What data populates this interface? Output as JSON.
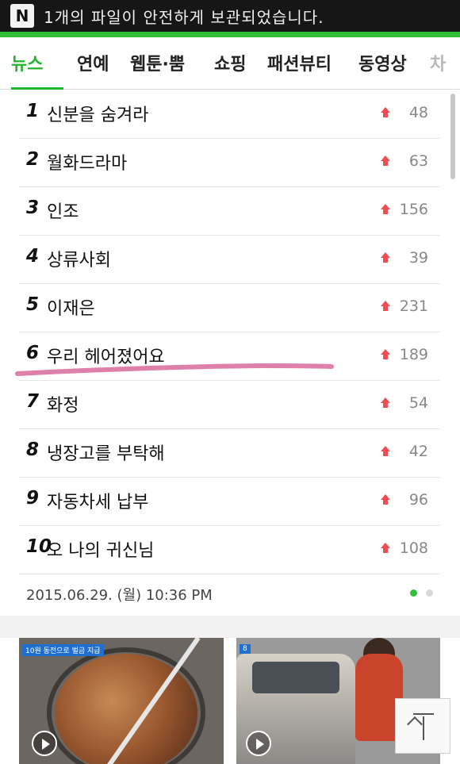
{
  "status_bar": {
    "icon_label": "N",
    "message": "1개의 파일이 안전하게 보관되었습니다."
  },
  "tabs": [
    {
      "label": "뉴스",
      "active": true
    },
    {
      "label": "연예"
    },
    {
      "label": "웹툰·뿜"
    },
    {
      "label": "쇼핑"
    },
    {
      "label": "패션뷰티"
    },
    {
      "label": "동영상"
    },
    {
      "label": "차"
    }
  ],
  "ranking": [
    {
      "rank": "1",
      "title": "신분을 숨겨라",
      "delta": "48"
    },
    {
      "rank": "2",
      "title": "월화드라마",
      "delta": "63"
    },
    {
      "rank": "3",
      "title": "인조",
      "delta": "156"
    },
    {
      "rank": "4",
      "title": "상류사회",
      "delta": "39"
    },
    {
      "rank": "5",
      "title": "이재은",
      "delta": "231"
    },
    {
      "rank": "6",
      "title": "우리 헤어졌어요",
      "delta": "189"
    },
    {
      "rank": "7",
      "title": "화정",
      "delta": "54"
    },
    {
      "rank": "8",
      "title": "냉장고를 부탁해",
      "delta": "42"
    },
    {
      "rank": "9",
      "title": "자동차세 납부",
      "delta": "96"
    },
    {
      "rank": "10",
      "title": "오 나의 귀신님",
      "delta": "108"
    }
  ],
  "timestamp": "2015.06.29. (월) 10:36 PM",
  "pagination": {
    "current": 1,
    "total": 2
  },
  "thumbnails": [
    {
      "caption": "10원 동전으로 벌금 지급"
    },
    {
      "caption": "8"
    }
  ],
  "colors": {
    "accent_green": "#2fc035",
    "rise_red": "#ef4d55",
    "highlight_pink": "#d96a9c"
  }
}
